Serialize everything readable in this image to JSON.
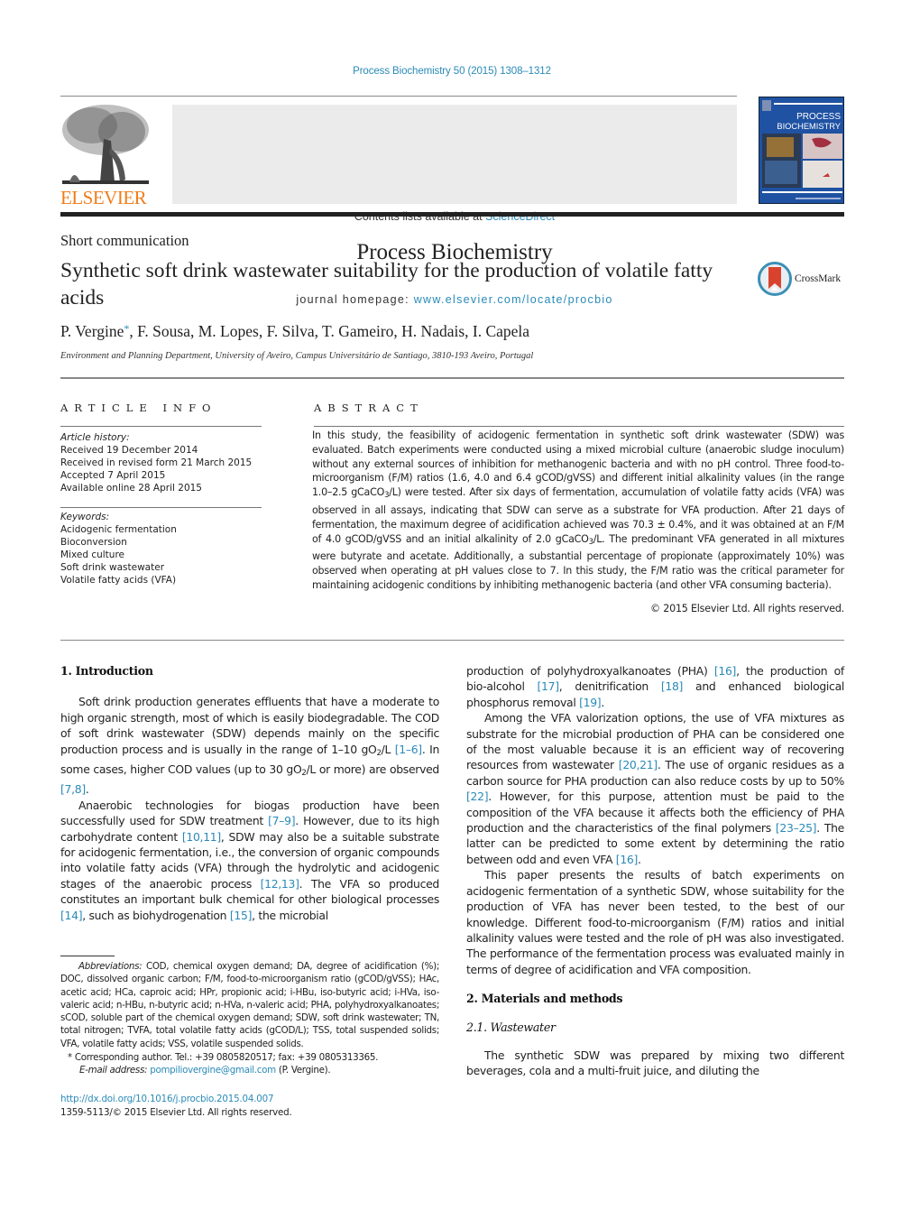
{
  "header": {
    "journal_reference": "Process Biochemistry 50 (2015) 1308–1312",
    "contents_prefix": "Contents lists available at ",
    "contents_link": "ScienceDirect",
    "journal_title": "Process Biochemistry",
    "homepage_prefix": "journal homepage: ",
    "homepage_link": "www.elsevier.com/locate/procbio",
    "publisher_logo": "ELSEVIER",
    "cover_title_line1": "PROCESS",
    "cover_title_line2": "BIOCHEMISTRY",
    "crossmark_label": "CrossMark",
    "accent_color": "#2a8ab8",
    "publisher_color": "#f07d1a"
  },
  "article": {
    "type": "Short communication",
    "title": "Synthetic soft drink wastewater suitability for the production of volatile fatty acids",
    "first_author": "P. Vergine",
    "corresponding_mark": "*",
    "other_authors": ", F. Sousa, M. Lopes, F. Silva, T. Gameiro, H. Nadais, I. Capela",
    "affiliation": "Environment and Planning Department, University of Aveiro, Campus Universitário de Santiago, 3810-193 Aveiro, Portugal"
  },
  "article_info": {
    "heading": "ARTICLE INFO",
    "history_label": "Article history:",
    "history": [
      "Received 19 December 2014",
      "Received in revised form 21 March 2015",
      "Accepted 7 April 2015",
      "Available online 28 April 2015"
    ],
    "keywords_label": "Keywords:",
    "keywords": [
      "Acidogenic fermentation",
      "Bioconversion",
      "Mixed culture",
      "Soft drink wastewater",
      "Volatile fatty acids (VFA)"
    ]
  },
  "abstract": {
    "heading": "ABSTRACT",
    "p1": "In this study, the feasibility of acidogenic fermentation in synthetic soft drink wastewater (SDW) was evaluated. Batch experiments were conducted using a mixed microbial culture (anaerobic sludge inoculum) without any external sources of inhibition for methanogenic bacteria and with no pH control. Three food-to-microorganism (F/M) ratios (1.6, 4.0 and 6.4 gCOD/gVSS) and different initial alkalinity values (in the range 1.0–2.5 gCaCO",
    "p2": "/L) were tested. After six days of fermentation, accumulation of volatile fatty acids (VFA) was observed in all assays, indicating that SDW can serve as a substrate for VFA production. After 21 days of fermentation, the maximum degree of acidification achieved was 70.3 ± 0.4%, and it was obtained at an F/M of 4.0 gCOD/gVSS and an initial alkalinity of 2.0 gCaCO",
    "p3": "/L. The predominant VFA generated in all mixtures were butyrate and acetate. Additionally, a substantial percentage of propionate (approximately 10%) was observed when operating at pH values close to 7. In this study, the F/M ratio was the critical parameter for maintaining acidogenic conditions by inhibiting methanogenic bacteria (and other VFA consuming bacteria).",
    "sub3": "3",
    "copyright": "© 2015 Elsevier Ltd. All rights reserved."
  },
  "body": {
    "intro_heading": "1.  Introduction",
    "intro_p1": {
      "a": "Soft drink production generates effluents that have a moderate to high organic strength, most of which is easily biodegradable. The COD of soft drink wastewater (SDW) depends mainly on the specific production process and is usually in the range of 1–10 gO",
      "b": "/L ",
      "ref1": "[1–6]",
      "c": ". In some cases, higher COD values (up to 30 gO",
      "d": "/L or more) are observed ",
      "ref2": "[7,8]",
      "e": "."
    },
    "intro_p2": {
      "a": "Anaerobic technologies for biogas production have been successfully used for SDW treatment ",
      "ref1": "[7–9]",
      "b": ". However, due to its high carbohydrate content ",
      "ref2": "[10,11]",
      "c": ", SDW may also be a suitable substrate for acidogenic fermentation, i.e., the conversion of organic compounds into volatile fatty acids (VFA) through the hydrolytic and acidogenic stages of the anaerobic process ",
      "ref3": "[12,13]",
      "d": ". The VFA so produced constitutes an important bulk chemical for other biological processes ",
      "ref4": "[14]",
      "e": ", such as biohydrogenation ",
      "ref5": "[15]",
      "f": ", the microbial production of polyhydroxyalkanoates (PHA) ",
      "ref6": "[16]",
      "g": ", the production of bio-alcohol ",
      "ref7": "[17]",
      "h": ", denitrification ",
      "ref8": "[18]",
      "i": " and enhanced biological phosphorus removal ",
      "ref9": "[19]",
      "j": "."
    },
    "intro_p3": {
      "a": "Among the VFA valorization options, the use of VFA mixtures as substrate for the microbial production of PHA can be considered one of the most valuable because it is an efficient way of recovering resources from wastewater ",
      "ref1": "[20,21]",
      "b": ". The use of organic residues as a carbon source for PHA production can also reduce costs by up to 50% ",
      "ref2": "[22]",
      "c": ". However, for this purpose, attention must be paid to the composition of the VFA because it affects both the efficiency of PHA production and the characteristics of the final polymers ",
      "ref3": "[23–25]",
      "d": ". The latter can be predicted to some extent by determining the ratio between odd and even VFA ",
      "ref4": "[16]",
      "e": "."
    },
    "intro_p4": "This paper presents the results of batch experiments on acidogenic fermentation of a synthetic SDW, whose suitability for the production of VFA has never been tested, to the best of our knowledge. Different food-to-microorganism (F/M) ratios and initial alkalinity values were tested and the role of pH was also investigated. The performance of the fermentation process was evaluated mainly in terms of degree of acidification and VFA composition.",
    "methods_heading": "2.  Materials and methods",
    "wastewater_heading": "2.1.  Wastewater",
    "wastewater_p1": "The synthetic SDW was prepared by mixing two different beverages, cola and a multi-fruit juice, and diluting the",
    "sub2": "2"
  },
  "footnotes": {
    "abbrev_label": "Abbreviations:",
    "abbrev_text": " COD, chemical oxygen demand; DA, degree of acidification (%); DOC, dissolved organic carbon; F/M, food-to-microorganism ratio (gCOD/gVSS); HAc, acetic acid; HCa, caproic acid; HPr, propionic acid; i-HBu, iso-butyric acid; i-HVa, iso-valeric acid; n-HBu, n-butyric acid; n-HVa, n-valeric acid; PHA, polyhydroxyalkanoates; sCOD, soluble part of the chemical oxygen demand; SDW, soft drink wastewater; TN, total nitrogen; TVFA, total volatile fatty acids (gCOD/L); TSS, total suspended solids; VFA, volatile fatty acids; VSS, volatile suspended solids.",
    "corresp_mark": "*",
    "corresp_text": " Corresponding author. Tel.: +39 0805820517; fax: +39 0805313365.",
    "email_label": "E-mail address:",
    "email": "pompiliovergine@gmail.com",
    "email_suffix": " (P. Vergine)."
  },
  "doi": {
    "link": "http://dx.doi.org/10.1016/j.procbio.2015.04.007",
    "issn_line": "1359-5113/© 2015 Elsevier Ltd. All rights reserved."
  }
}
